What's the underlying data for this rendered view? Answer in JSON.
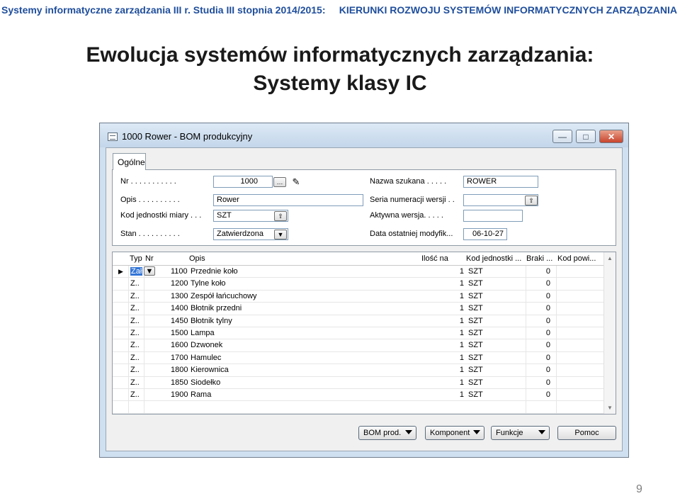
{
  "header": {
    "left": "Systemy informatyczne zarządzania III r. Studia III stopnia 2014/2015:",
    "right": "KIERUNKI ROZWOJU SYSTEMÓW INFORMATYCZNYCH ZARZĄDZANIA"
  },
  "slide": {
    "title_line1": "Ewolucja systemów informatycznych zarządzania:",
    "title_line2": "Systemy klasy IC",
    "page_number": "9"
  },
  "window": {
    "title": "1000 Rower - BOM produkcyjny",
    "minimize_label": "—",
    "maximize_label": "□",
    "close_label": "✕",
    "tab_label": "Ogólne",
    "fields": {
      "nr_label": "Nr . . . . . . . . . . .",
      "nr_value": "1000",
      "opis_label": "Opis . . . . . . . . . .",
      "opis_value": "Rower",
      "kod_label": "Kod jednostki miary . . .",
      "kod_value": "SZT",
      "stan_label": "Stan . . . . . . . . . .",
      "stan_value": "Zatwierdzona",
      "nazwa_label": "Nazwa szukana . . . . .",
      "nazwa_value": "ROWER",
      "seria_label": "Seria numeracji wersji . .",
      "seria_value": "",
      "aktywna_label": "Aktywna wersja. . . . .",
      "aktywna_value": "",
      "data_label": "Data ostatniej modyfik...",
      "data_value": "06-10-27"
    },
    "grid": {
      "headers": [
        "Typ",
        "Nr",
        "Opis",
        "Ilość na",
        "Kod jednostki ...",
        "Braki ...",
        "Kod powi..."
      ],
      "rows": [
        {
          "typ": "Z..",
          "nr": "1100",
          "opis": "Przednie koło",
          "ilosc": "1",
          "kod": "SZT",
          "braki": "0"
        },
        {
          "typ": "Z..",
          "nr": "1200",
          "opis": "Tylne koło",
          "ilosc": "1",
          "kod": "SZT",
          "braki": "0"
        },
        {
          "typ": "Z..",
          "nr": "1300",
          "opis": "Zespół łańcuchowy",
          "ilosc": "1",
          "kod": "SZT",
          "braki": "0"
        },
        {
          "typ": "Z..",
          "nr": "1400",
          "opis": "Błotnik przedni",
          "ilosc": "1",
          "kod": "SZT",
          "braki": "0"
        },
        {
          "typ": "Z..",
          "nr": "1450",
          "opis": "Błotnik tylny",
          "ilosc": "1",
          "kod": "SZT",
          "braki": "0"
        },
        {
          "typ": "Z..",
          "nr": "1500",
          "opis": "Lampa",
          "ilosc": "1",
          "kod": "SZT",
          "braki": "0"
        },
        {
          "typ": "Z..",
          "nr": "1600",
          "opis": "Dzwonek",
          "ilosc": "1",
          "kod": "SZT",
          "braki": "0"
        },
        {
          "typ": "Z..",
          "nr": "1700",
          "opis": "Hamulec",
          "ilosc": "1",
          "kod": "SZT",
          "braki": "0"
        },
        {
          "typ": "Z..",
          "nr": "1800",
          "opis": "Kierownica",
          "ilosc": "1",
          "kod": "SZT",
          "braki": "0"
        },
        {
          "typ": "Z..",
          "nr": "1850",
          "opis": "Siodełko",
          "ilosc": "1",
          "kod": "SZT",
          "braki": "0"
        },
        {
          "typ": "Z..",
          "nr": "1900",
          "opis": "Rama",
          "ilosc": "1",
          "kod": "SZT",
          "braki": "0"
        }
      ],
      "first_row_typ": "Zał"
    },
    "buttons": {
      "bom": "BOM prod.",
      "komponent": "Komponent",
      "funkcje": "Funkcje",
      "pomoc": "Pomoc"
    }
  },
  "colors": {
    "header_text": "#1f4e9c",
    "window_frame": "#cfe0f1"
  }
}
